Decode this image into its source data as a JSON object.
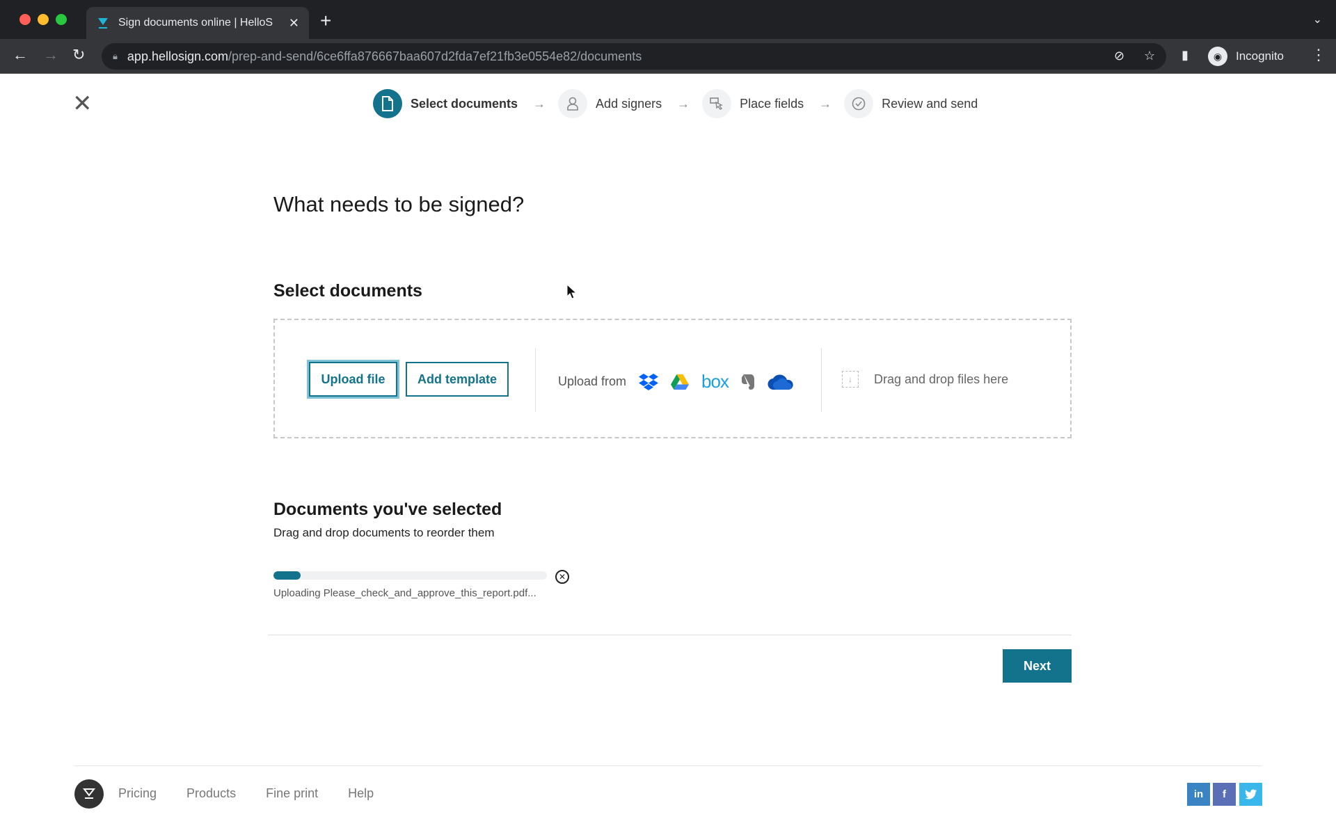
{
  "browser": {
    "tab_title": "Sign documents online | HelloS",
    "url_host": "app.hellosign.com",
    "url_path": "/prep-and-send/6ce6ffa876667baa607d2fda7ef21fb3e0554e82/documents",
    "profile_label": "Incognito"
  },
  "stepper": {
    "steps": [
      {
        "label": "Select documents",
        "icon": "document-icon",
        "active": true
      },
      {
        "label": "Add signers",
        "icon": "person-icon",
        "active": false
      },
      {
        "label": "Place fields",
        "icon": "field-cursor-icon",
        "active": false
      },
      {
        "label": "Review and send",
        "icon": "check-circle-icon",
        "active": false
      }
    ]
  },
  "main": {
    "title": "What needs to be signed?",
    "select_heading": "Select documents",
    "upload_file_label": "Upload file",
    "add_template_label": "Add template",
    "upload_from_label": "Upload from",
    "services": [
      "Dropbox",
      "Google Drive",
      "Box",
      "Evernote",
      "OneDrive"
    ],
    "drag_drop_label": "Drag and drop files here",
    "selected_heading": "Documents you've selected",
    "selected_sub": "Drag and drop documents to reorder them",
    "upload_progress_percent": 10,
    "uploading_text": "Uploading Please_check_and_approve_this_report.pdf...",
    "next_label": "Next"
  },
  "footer": {
    "links": [
      "Pricing",
      "Products",
      "Fine print",
      "Help"
    ],
    "social": [
      "in",
      "f",
      "t"
    ]
  },
  "colors": {
    "accent": "#13728c",
    "linkedin": "#3b84c4",
    "facebook": "#5b6fb7",
    "twitter": "#3ab7ea"
  }
}
